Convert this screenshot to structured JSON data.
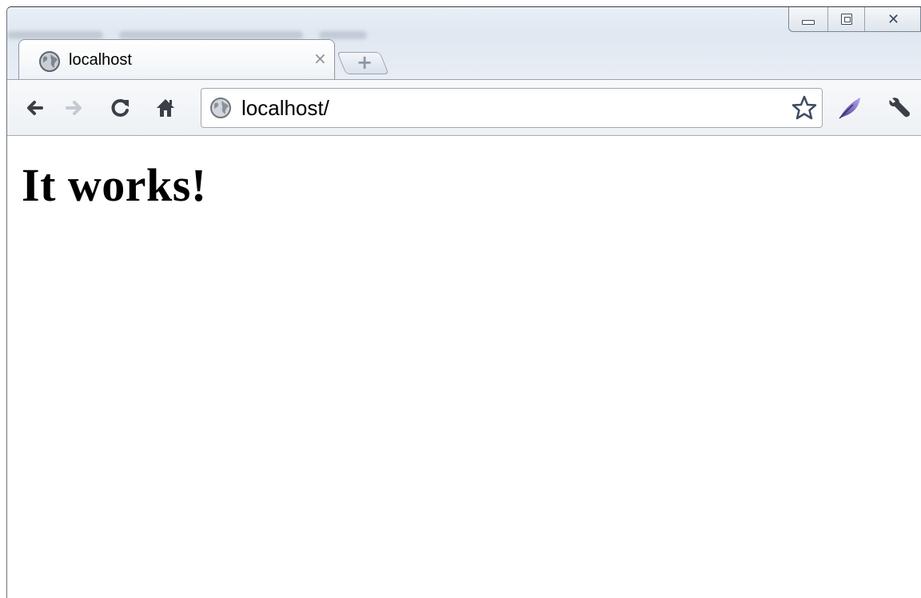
{
  "tab": {
    "title": "localhost",
    "close_glyph": "×"
  },
  "new_tab": {
    "glyph": "+"
  },
  "window_controls": {
    "minimize": "minimize-icon",
    "maximize": "maximize-icon",
    "close": "close-icon",
    "close_glyph": "✕"
  },
  "toolbar": {
    "back": "back-arrow-icon",
    "forward": "forward-arrow-icon",
    "reload": "reload-icon",
    "home": "home-icon",
    "extension": "feather-icon",
    "wrench": "wrench-icon"
  },
  "omnibox": {
    "url": "localhost/",
    "star": "star-icon"
  },
  "page": {
    "heading": "It works!"
  },
  "colors": {
    "frame": "#6d737b",
    "toolbar_bg": "#eef1f4",
    "tab_bg": "#ffffff",
    "feather": "#7a63c2"
  }
}
